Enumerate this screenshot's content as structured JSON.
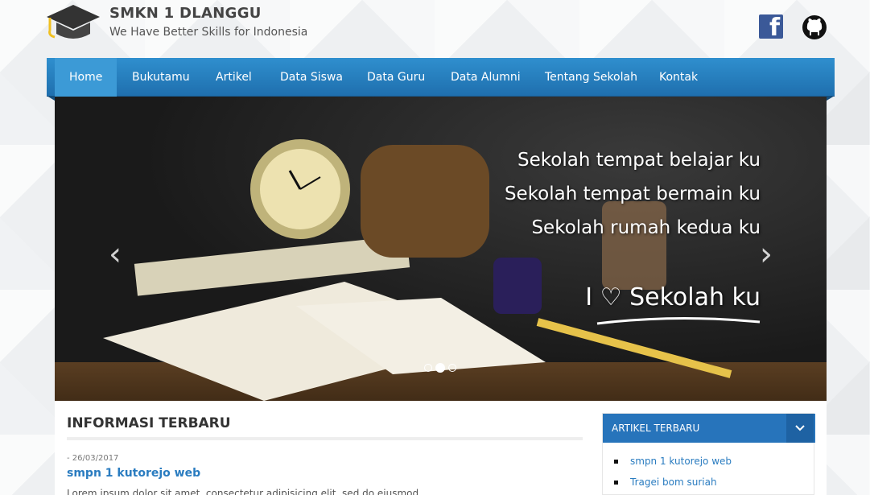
{
  "site": {
    "title": "SMKN 1 DLANGGU",
    "tagline": "We Have Better Skills for Indonesia"
  },
  "nav": {
    "items": [
      {
        "label": "Home",
        "active": true
      },
      {
        "label": "Bukutamu"
      },
      {
        "label": "Artikel"
      },
      {
        "label": "Data Siswa"
      },
      {
        "label": "Data Guru"
      },
      {
        "label": "Data Alumni"
      },
      {
        "label": "Tentang Sekolah"
      },
      {
        "label": "Kontak"
      }
    ]
  },
  "slider": {
    "line1": "Sekolah tempat belajar ku",
    "line2": "Sekolah tempat bermain ku",
    "line3": "Sekolah rumah kedua ku",
    "big": "I ♡ Sekolah ku",
    "active_dot": 2,
    "dot_count": 3
  },
  "main": {
    "heading": "INFORMASI TERBARU",
    "post": {
      "date": "- 26/03/2017",
      "title": "smpn 1 kutorejo web",
      "excerpt": "Lorem ipsum dolor sit amet, consectetur adipisicing elit, sed do eiusmod"
    }
  },
  "sidebar": {
    "widget_title": "ARTIKEL TERBARU",
    "items": [
      "smpn 1 kutorejo web",
      "Tragei bom suriah"
    ]
  },
  "icons": {
    "logo": "graduation-cap-icon",
    "facebook": "facebook-icon",
    "github": "github-icon",
    "prev": "chevron-left-icon",
    "next": "chevron-right-icon",
    "toggle": "chevron-down-icon"
  },
  "colors": {
    "nav": "#2f8fce",
    "nav_active": "#3c9ad6",
    "link": "#2a7cc0",
    "widget_head": "#2774bb"
  }
}
